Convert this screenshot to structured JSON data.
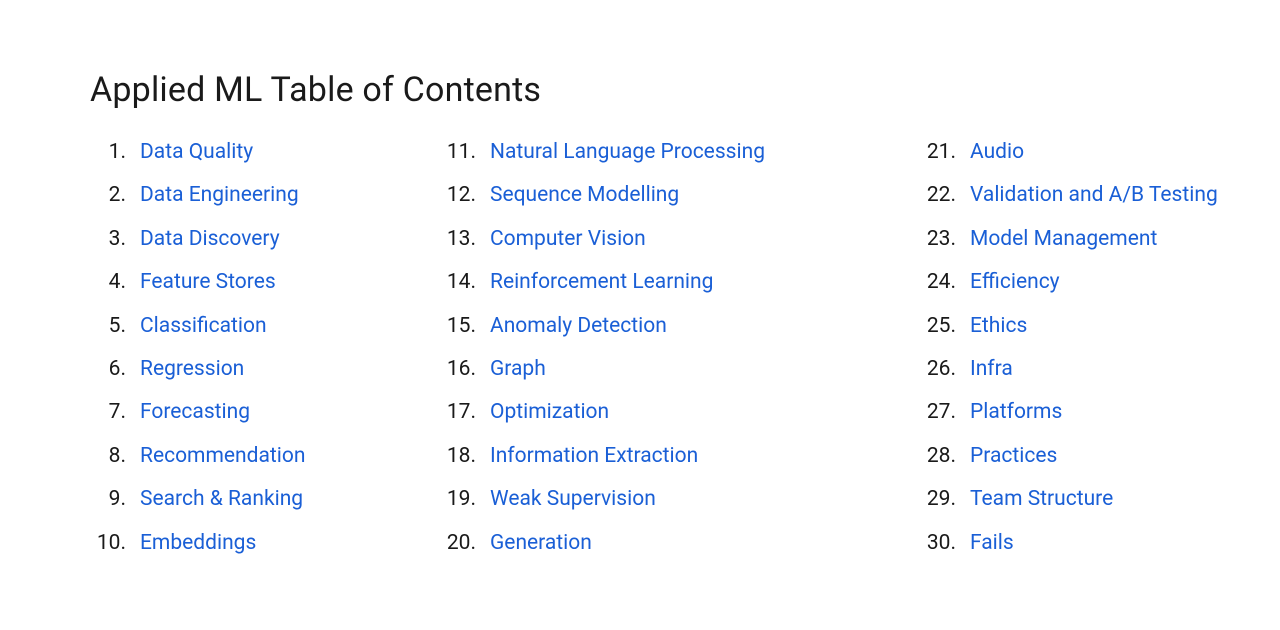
{
  "title": "Applied ML Table of Contents",
  "columns": [
    {
      "items": [
        {
          "num": "1.",
          "label": "Data Quality"
        },
        {
          "num": "2.",
          "label": "Data Engineering"
        },
        {
          "num": "3.",
          "label": "Data Discovery"
        },
        {
          "num": "4.",
          "label": "Feature Stores"
        },
        {
          "num": "5.",
          "label": "Classification"
        },
        {
          "num": "6.",
          "label": "Regression"
        },
        {
          "num": "7.",
          "label": "Forecasting"
        },
        {
          "num": "8.",
          "label": "Recommendation"
        },
        {
          "num": "9.",
          "label": "Search & Ranking"
        },
        {
          "num": "10.",
          "label": "Embeddings"
        }
      ]
    },
    {
      "items": [
        {
          "num": "11.",
          "label": "Natural Language Processing"
        },
        {
          "num": "12.",
          "label": "Sequence Modelling"
        },
        {
          "num": "13.",
          "label": "Computer Vision"
        },
        {
          "num": "14.",
          "label": "Reinforcement Learning"
        },
        {
          "num": "15.",
          "label": "Anomaly Detection"
        },
        {
          "num": "16.",
          "label": "Graph"
        },
        {
          "num": "17.",
          "label": "Optimization"
        },
        {
          "num": "18.",
          "label": "Information Extraction"
        },
        {
          "num": "19.",
          "label": "Weak Supervision"
        },
        {
          "num": "20.",
          "label": "Generation"
        }
      ]
    },
    {
      "items": [
        {
          "num": "21.",
          "label": "Audio"
        },
        {
          "num": "22.",
          "label": "Validation and A/B Testing"
        },
        {
          "num": "23.",
          "label": "Model Management"
        },
        {
          "num": "24.",
          "label": "Efficiency"
        },
        {
          "num": "25.",
          "label": "Ethics"
        },
        {
          "num": "26.",
          "label": "Infra"
        },
        {
          "num": "27.",
          "label": "Platforms"
        },
        {
          "num": "28.",
          "label": "Practices"
        },
        {
          "num": "29.",
          "label": "Team Structure"
        },
        {
          "num": "30.",
          "label": "Fails"
        }
      ]
    }
  ]
}
